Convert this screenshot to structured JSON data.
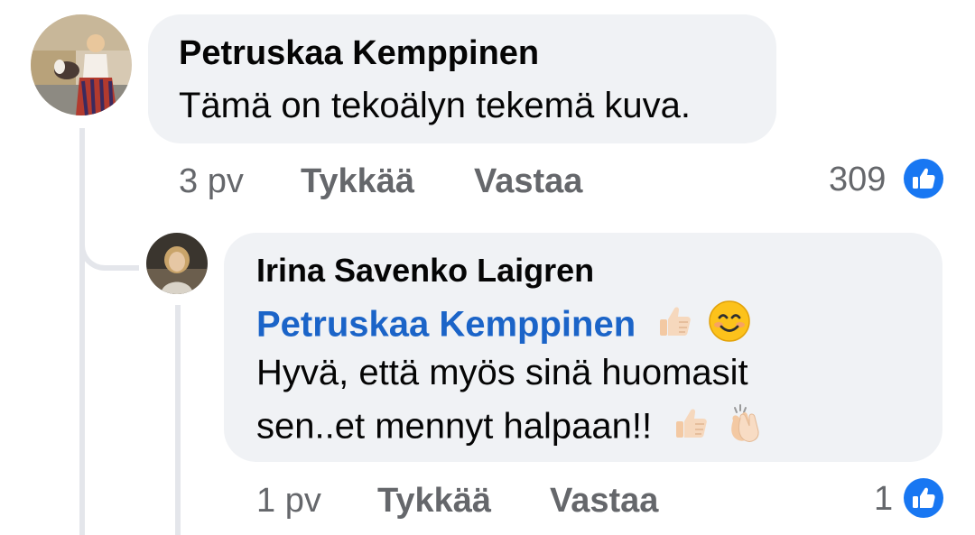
{
  "comment": {
    "author": "Petruskaa Kemppinen",
    "text": "Tämä on tekoälyn tekemä kuva.",
    "time": "3 pv",
    "like_label": "Tykkää",
    "reply_label": "Vastaa",
    "reaction_count": "309"
  },
  "reply": {
    "author": "Irina Savenko Laigren",
    "mention": "Petruskaa Kemppinen",
    "line1": "Hyvä, että myös sinä huomasit",
    "line2": "sen..et mennyt halpaan!!",
    "time": "1 pv",
    "like_label": "Tykkää",
    "reply_label": "Vastaa",
    "reaction_count": "1"
  },
  "colors": {
    "bubble": "#f0f2f5",
    "mention": "#1b64c8",
    "meta": "#65676b",
    "like_blue": "#1877f2"
  }
}
